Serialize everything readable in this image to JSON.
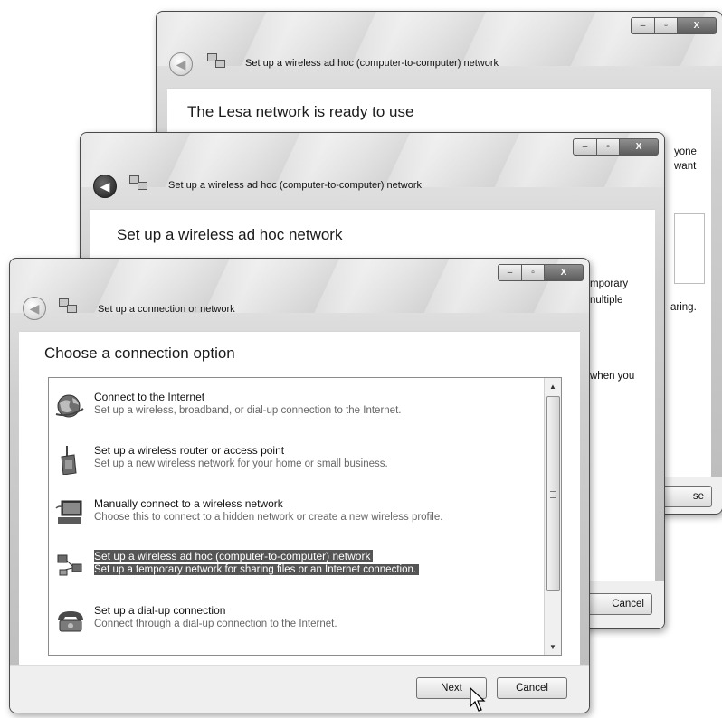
{
  "window_back": {
    "title": "Set up a wireless ad hoc (computer-to-computer) network",
    "heading": "The Lesa network is ready to use",
    "fragments": {
      "line1": "yone",
      "line2": "want",
      "line3": "aring."
    },
    "close_button_partial": "se"
  },
  "window_middle": {
    "title": "Set up a wireless ad hoc (computer-to-computer) network",
    "heading": "Set up a wireless ad hoc network",
    "fragments": {
      "line1": "mporary",
      "line2": "nultiple",
      "line3": "when you"
    },
    "cancel_label": "Cancel"
  },
  "window_front": {
    "title": "Set up a connection or network",
    "heading": "Choose a connection option",
    "options": [
      {
        "title": "Connect to the Internet",
        "desc": "Set up a wireless, broadband, or dial-up connection to the Internet.",
        "icon": "globe-icon"
      },
      {
        "title": "Set up a wireless router or access point",
        "desc": "Set up a new wireless network for your home or small business.",
        "icon": "router-icon"
      },
      {
        "title": "Manually connect to a wireless network",
        "desc": "Choose this to connect to a hidden network or create a new wireless profile.",
        "icon": "wireless-computer-icon"
      },
      {
        "title": "Set up a wireless ad hoc (computer-to-computer) network",
        "desc": "Set up a temporary network for sharing files or an Internet connection.",
        "icon": "adhoc-network-icon",
        "selected": true
      },
      {
        "title": "Set up a dial-up connection",
        "desc": "Connect through a dial-up connection to the Internet.",
        "icon": "telephone-icon"
      }
    ],
    "next_label": "Next",
    "cancel_label": "Cancel"
  },
  "caption": {
    "minimize": "‒",
    "maximize": "▫",
    "close": "X"
  }
}
